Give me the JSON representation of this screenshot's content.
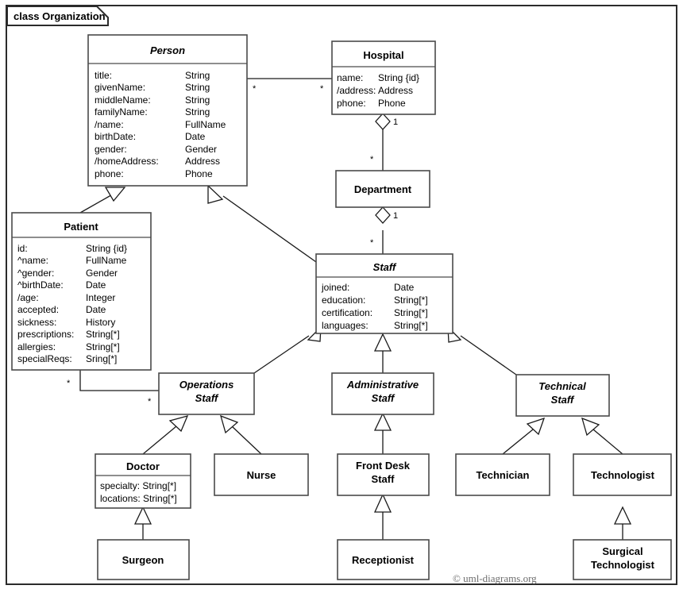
{
  "frame": {
    "label": "class Organization",
    "copyright": "© uml-diagrams.org"
  },
  "classes": {
    "person": {
      "name": "Person",
      "abstract": true,
      "attributes": [
        {
          "name": "title:",
          "type": "String"
        },
        {
          "name": "givenName:",
          "type": "String"
        },
        {
          "name": "middleName:",
          "type": "String"
        },
        {
          "name": "familyName:",
          "type": "String"
        },
        {
          "name": "/name:",
          "type": "FullName"
        },
        {
          "name": "birthDate:",
          "type": "Date"
        },
        {
          "name": "gender:",
          "type": "Gender"
        },
        {
          "name": "/homeAddress:",
          "type": "Address"
        },
        {
          "name": "phone:",
          "type": "Phone"
        }
      ]
    },
    "hospital": {
      "name": "Hospital",
      "abstract": false,
      "attributes": [
        {
          "name": "name:",
          "type": "String {id}"
        },
        {
          "name": "/address:",
          "type": "Address"
        },
        {
          "name": "phone:",
          "type": "Phone"
        }
      ]
    },
    "patient": {
      "name": "Patient",
      "abstract": false,
      "attributes": [
        {
          "name": "id:",
          "type": "String {id}"
        },
        {
          "name": "^name:",
          "type": "FullName"
        },
        {
          "name": "^gender:",
          "type": "Gender"
        },
        {
          "name": "^birthDate:",
          "type": "Date"
        },
        {
          "name": "/age:",
          "type": "Integer"
        },
        {
          "name": "accepted:",
          "type": "Date"
        },
        {
          "name": "sickness:",
          "type": "History"
        },
        {
          "name": "prescriptions:",
          "type": "String[*]"
        },
        {
          "name": "allergies:",
          "type": "String[*]"
        },
        {
          "name": "specialReqs:",
          "type": "Sring[*]"
        }
      ]
    },
    "department": {
      "name": "Department",
      "abstract": false,
      "attributes": []
    },
    "staff": {
      "name": "Staff",
      "abstract": true,
      "attributes": [
        {
          "name": "joined:",
          "type": "Date"
        },
        {
          "name": "education:",
          "type": "String[*]"
        },
        {
          "name": "certification:",
          "type": "String[*]"
        },
        {
          "name": "languages:",
          "type": "String[*]"
        }
      ]
    },
    "operations_staff": {
      "name_line1": "Operations",
      "name_line2": "Staff",
      "abstract": true
    },
    "administrative_staff": {
      "name_line1": "Administrative",
      "name_line2": "Staff",
      "abstract": true
    },
    "technical_staff": {
      "name_line1": "Technical",
      "name_line2": "Staff",
      "abstract": true
    },
    "doctor": {
      "name": "Doctor",
      "abstract": false,
      "attributes": [
        {
          "name": "specialty:",
          "type": "String[*]"
        },
        {
          "name": "locations:",
          "type": "String[*]"
        }
      ]
    },
    "nurse": {
      "name": "Nurse",
      "abstract": false
    },
    "front_desk_staff": {
      "name_line1": "Front Desk",
      "name_line2": "Staff",
      "abstract": false
    },
    "technician": {
      "name": "Technician",
      "abstract": false
    },
    "technologist": {
      "name": "Technologist",
      "abstract": false
    },
    "surgeon": {
      "name": "Surgeon",
      "abstract": false
    },
    "receptionist": {
      "name": "Receptionist",
      "abstract": false
    },
    "surgical_technologist": {
      "name_line1": "Surgical",
      "name_line2": "Technologist",
      "abstract": false
    }
  },
  "multiplicities": {
    "person_hospital_person_end": "*",
    "person_hospital_hospital_end": "*",
    "hospital_department_hospital_end": "1",
    "hospital_department_department_end": "*",
    "department_staff_department_end": "1",
    "department_staff_staff_end": "*",
    "patient_operations_patient_end": "*",
    "patient_operations_operations_end": "*"
  },
  "relationships": [
    {
      "kind": "generalization",
      "from": "Patient",
      "to": "Person"
    },
    {
      "kind": "generalization",
      "from": "Staff",
      "to": "Person"
    },
    {
      "kind": "association",
      "from": "Person",
      "to": "Hospital"
    },
    {
      "kind": "aggregation",
      "whole": "Hospital",
      "part": "Department"
    },
    {
      "kind": "aggregation",
      "whole": "Department",
      "part": "Staff"
    },
    {
      "kind": "association",
      "from": "Patient",
      "to": "Operations Staff"
    },
    {
      "kind": "generalization",
      "from": "Operations Staff",
      "to": "Staff"
    },
    {
      "kind": "generalization",
      "from": "Administrative Staff",
      "to": "Staff"
    },
    {
      "kind": "generalization",
      "from": "Technical Staff",
      "to": "Staff"
    },
    {
      "kind": "generalization",
      "from": "Doctor",
      "to": "Operations Staff"
    },
    {
      "kind": "generalization",
      "from": "Nurse",
      "to": "Operations Staff"
    },
    {
      "kind": "generalization",
      "from": "Front Desk Staff",
      "to": "Administrative Staff"
    },
    {
      "kind": "generalization",
      "from": "Technician",
      "to": "Technical Staff"
    },
    {
      "kind": "generalization",
      "from": "Technologist",
      "to": "Technical Staff"
    },
    {
      "kind": "generalization",
      "from": "Surgeon",
      "to": "Doctor"
    },
    {
      "kind": "generalization",
      "from": "Receptionist",
      "to": "Front Desk Staff"
    },
    {
      "kind": "generalization",
      "from": "Surgical Technologist",
      "to": "Technologist"
    }
  ]
}
